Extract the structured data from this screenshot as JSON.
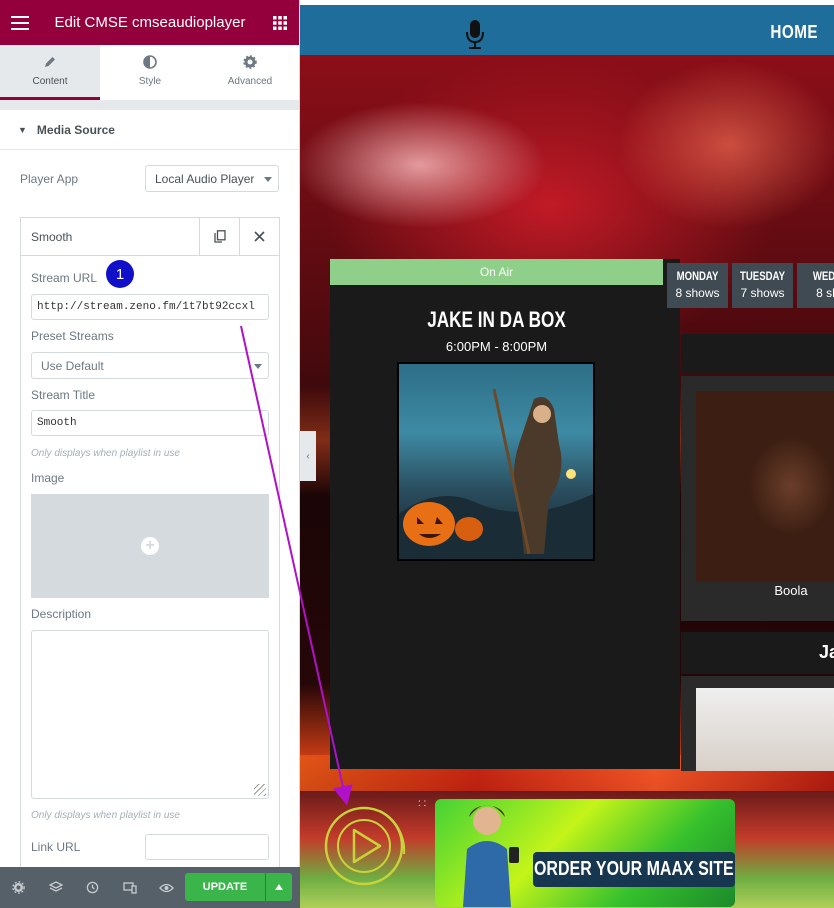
{
  "editor": {
    "header_title": "Edit CMSE cmseaudioplayer",
    "tabs": [
      {
        "label": "Content",
        "icon": "pencil-icon",
        "active": true
      },
      {
        "label": "Style",
        "icon": "half-circle-icon",
        "active": false
      },
      {
        "label": "Advanced",
        "icon": "gear-icon",
        "active": false
      }
    ],
    "section_title": "Media Source",
    "player_app_label": "Player App",
    "player_app_value": "Local Audio Player",
    "item_title": "Smooth",
    "stream_url_label": "Stream URL",
    "stream_url_value": "http://stream.zeno.fm/1t7bt92ccxl",
    "annotation_badge": "1",
    "preset_streams_label": "Preset Streams",
    "preset_streams_value": "Use Default",
    "stream_title_label": "Stream Title",
    "stream_title_value": "Smooth",
    "stream_title_hint": "Only displays when playlist in use",
    "image_label": "Image",
    "description_label": "Description",
    "description_hint": "Only displays when playlist in use",
    "link_url_label": "Link URL",
    "update_label": "UPDATE",
    "accent_color": "#93003c",
    "update_color": "#39b54a"
  },
  "preview": {
    "nav_home": "HOME",
    "on_air_label": "On Air",
    "show_title": "JAKE IN DA BOX",
    "show_time": "6:00PM - 8:00PM",
    "days": [
      {
        "name": "MONDAY",
        "count": "8 shows"
      },
      {
        "name": "TUESDAY",
        "count": "7 shows"
      },
      {
        "name": "WEDN",
        "count": "8 sh"
      }
    ],
    "card_name": "Boola",
    "card3_title": "Ja",
    "ad_text": "ORDER YOUR MAAX SITE",
    "dots": ": :"
  }
}
